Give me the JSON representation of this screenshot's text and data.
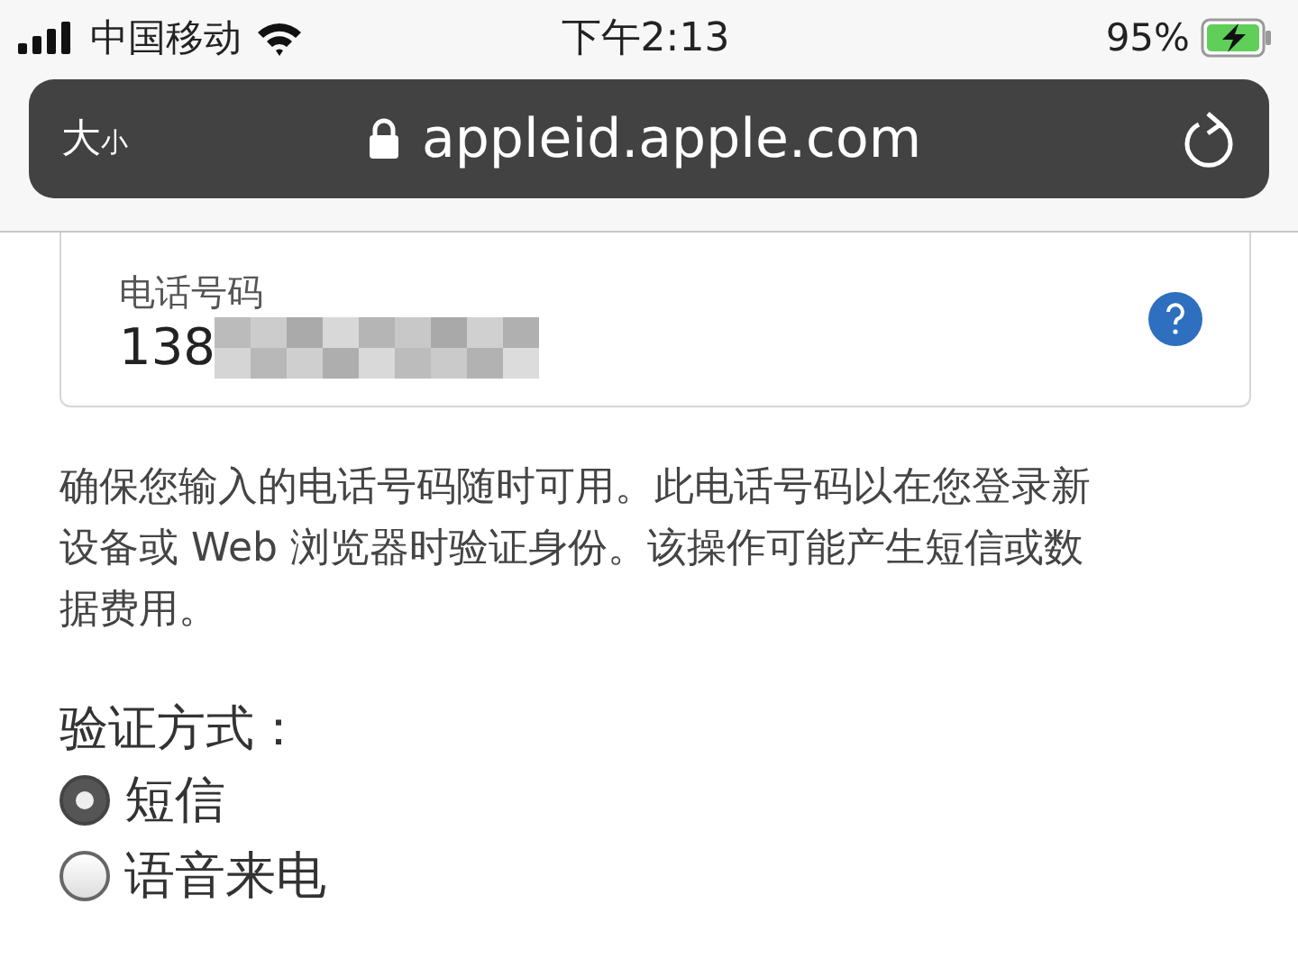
{
  "status_bar": {
    "carrier": "中国移动",
    "time": "下午2:13",
    "battery": "95%"
  },
  "address_bar": {
    "text_size": "大",
    "text_size_small": "小",
    "url": "appleid.apple.com"
  },
  "phone_field": {
    "label": "电话号码",
    "value": "138"
  },
  "notice": "确保您输入的电话号码随时可用。此电话号码以在您登录新设备或 Web 浏览器时验证身份。该操作可能产生短信或数据费用。",
  "verification": {
    "label": "验证方式：",
    "options": [
      {
        "label": "短信",
        "selected": true
      },
      {
        "label": "语音来电",
        "selected": false
      }
    ]
  }
}
